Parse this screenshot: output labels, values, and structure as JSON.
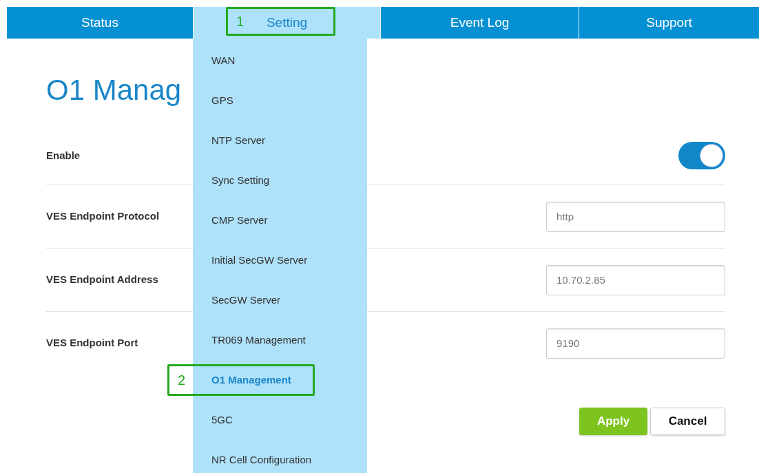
{
  "nav": [
    {
      "label": "Status",
      "selected": false
    },
    {
      "label": "Setting",
      "selected": true,
      "callout": "1"
    },
    {
      "label": "Event Log",
      "selected": false
    },
    {
      "label": "Support",
      "selected": false
    }
  ],
  "menu": [
    {
      "label": "WAN",
      "selected": false
    },
    {
      "label": "GPS",
      "selected": false
    },
    {
      "label": "NTP Server",
      "selected": false
    },
    {
      "label": "Sync Setting",
      "selected": false
    },
    {
      "label": "CMP Server",
      "selected": false
    },
    {
      "label": "Initial SecGW Server",
      "selected": false
    },
    {
      "label": "SecGW Server",
      "selected": false
    },
    {
      "label": "TR069 Management",
      "selected": false
    },
    {
      "label": "O1 Management",
      "selected": true,
      "callout": "2"
    },
    {
      "label": "5GC",
      "selected": false
    },
    {
      "label": "NR Cell Configuration",
      "selected": false
    }
  ],
  "title": "O1 Manag",
  "fields": [
    {
      "kind": "toggle",
      "label": "Enable",
      "on": true
    },
    {
      "kind": "text",
      "label": "VES Endpoint Protocol",
      "value": "http"
    },
    {
      "kind": "text",
      "label": "VES Endpoint Address",
      "value": "10.70.2.85"
    },
    {
      "kind": "text",
      "label": "VES Endpoint Port",
      "value": "9190"
    }
  ],
  "buttons": [
    {
      "kind": "primary",
      "label": "Apply"
    },
    {
      "kind": "secondary",
      "label": "Cancel"
    }
  ]
}
